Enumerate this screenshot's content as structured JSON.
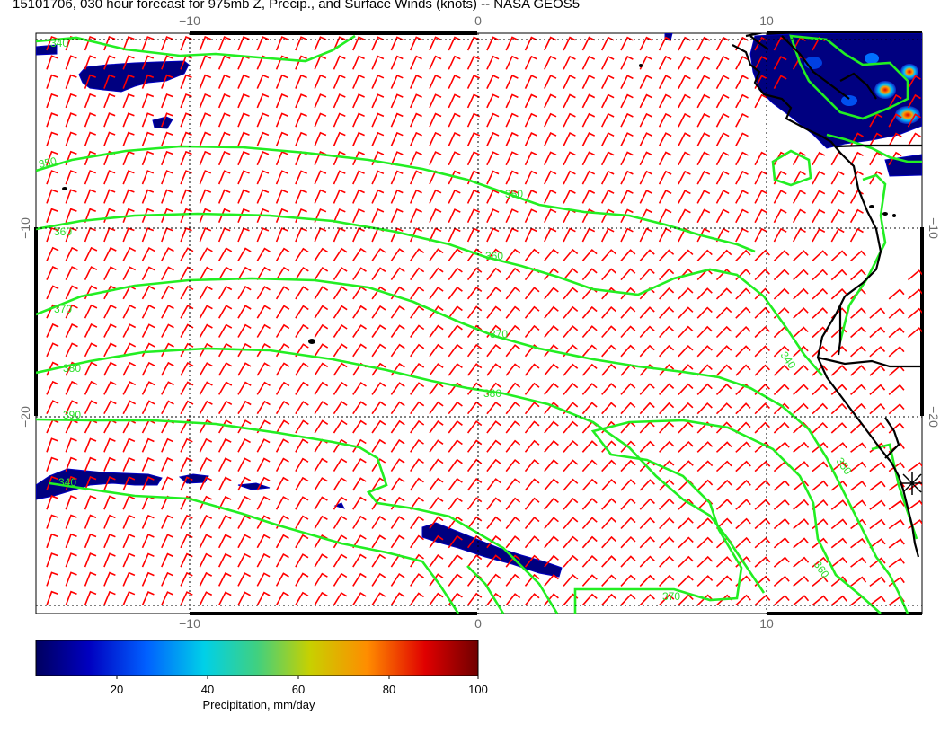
{
  "title": "15101706, 030 hour forecast for 975mb Z, Precip., and Surface Winds (knots) -- NASA GEOS5",
  "axes": {
    "top_ticks": [
      "−10",
      "0",
      "10"
    ],
    "bottom_ticks": [
      "−10",
      "0",
      "10"
    ],
    "left_ticks": [
      "−10",
      "−20"
    ],
    "right_ticks": [
      "−10",
      "−20"
    ]
  },
  "contour_labels": [
    "340",
    "350",
    "360",
    "370",
    "380",
    "390",
    "340",
    "350",
    "360",
    "370",
    "380",
    "340",
    "350",
    "360",
    "370"
  ],
  "colorbar": {
    "label": "Precipitation, mm/day",
    "ticks": [
      "20",
      "40",
      "60",
      "80",
      "100"
    ],
    "colors": [
      "#000080",
      "#0000ff",
      "#00a0ff",
      "#00e0e0",
      "#60d060",
      "#d0d000",
      "#ff8000",
      "#e00000",
      "#800000"
    ]
  },
  "colors": {
    "wind_barbs": "#ff0000",
    "contours": "#22ee22",
    "coastline": "#000000",
    "precip_low": "#000080"
  }
}
